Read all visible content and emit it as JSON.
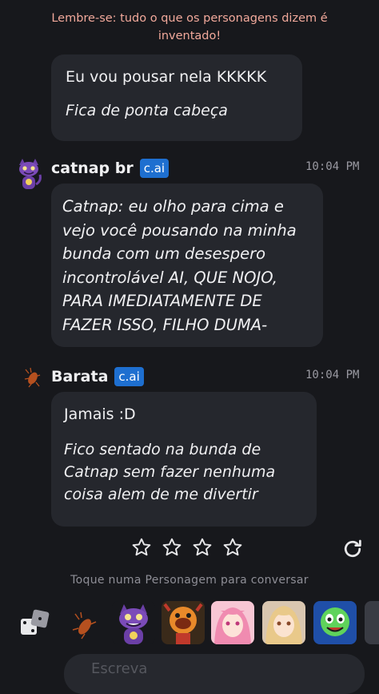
{
  "banner": {
    "line1": "Lembre-se: tudo o que os personagens dizem é",
    "line2": "inventado!"
  },
  "messages": [
    {
      "lines": [
        "Eu vou pousar nela KKKKK",
        "Fica de ponta cabeça"
      ]
    },
    {
      "author": "catnap br",
      "badge": "c.ai",
      "time": "10:04 PM",
      "lines": [
        "Catnap: eu olho para cima e",
        "vejo você pousando na minha",
        "bunda com um desespero",
        "incontrolável AI, QUE NOJO,",
        "PARA IMEDIATAMENTE DE",
        "FAZER ISSO, FILHO DUMA-"
      ]
    },
    {
      "author": "Barata",
      "badge": "c.ai",
      "time": "10:04 PM",
      "lines": [
        "Jamais :D",
        "Fico sentado na bunda de",
        "Catnap sem fazer nenhuma",
        "coisa alem de me divertir"
      ]
    }
  ],
  "rating": {
    "stars": 4
  },
  "hint": "Toque numa Personagem para conversar",
  "input": {
    "placeholder": "Escreva"
  },
  "colors": {
    "banner": "#f2a99b",
    "badge": "#1e6fd0",
    "bubble": "#25272d",
    "background": "#17181c"
  },
  "icons": [
    "dice-icon",
    "cockroach-icon",
    "star-icon",
    "refresh-icon"
  ]
}
